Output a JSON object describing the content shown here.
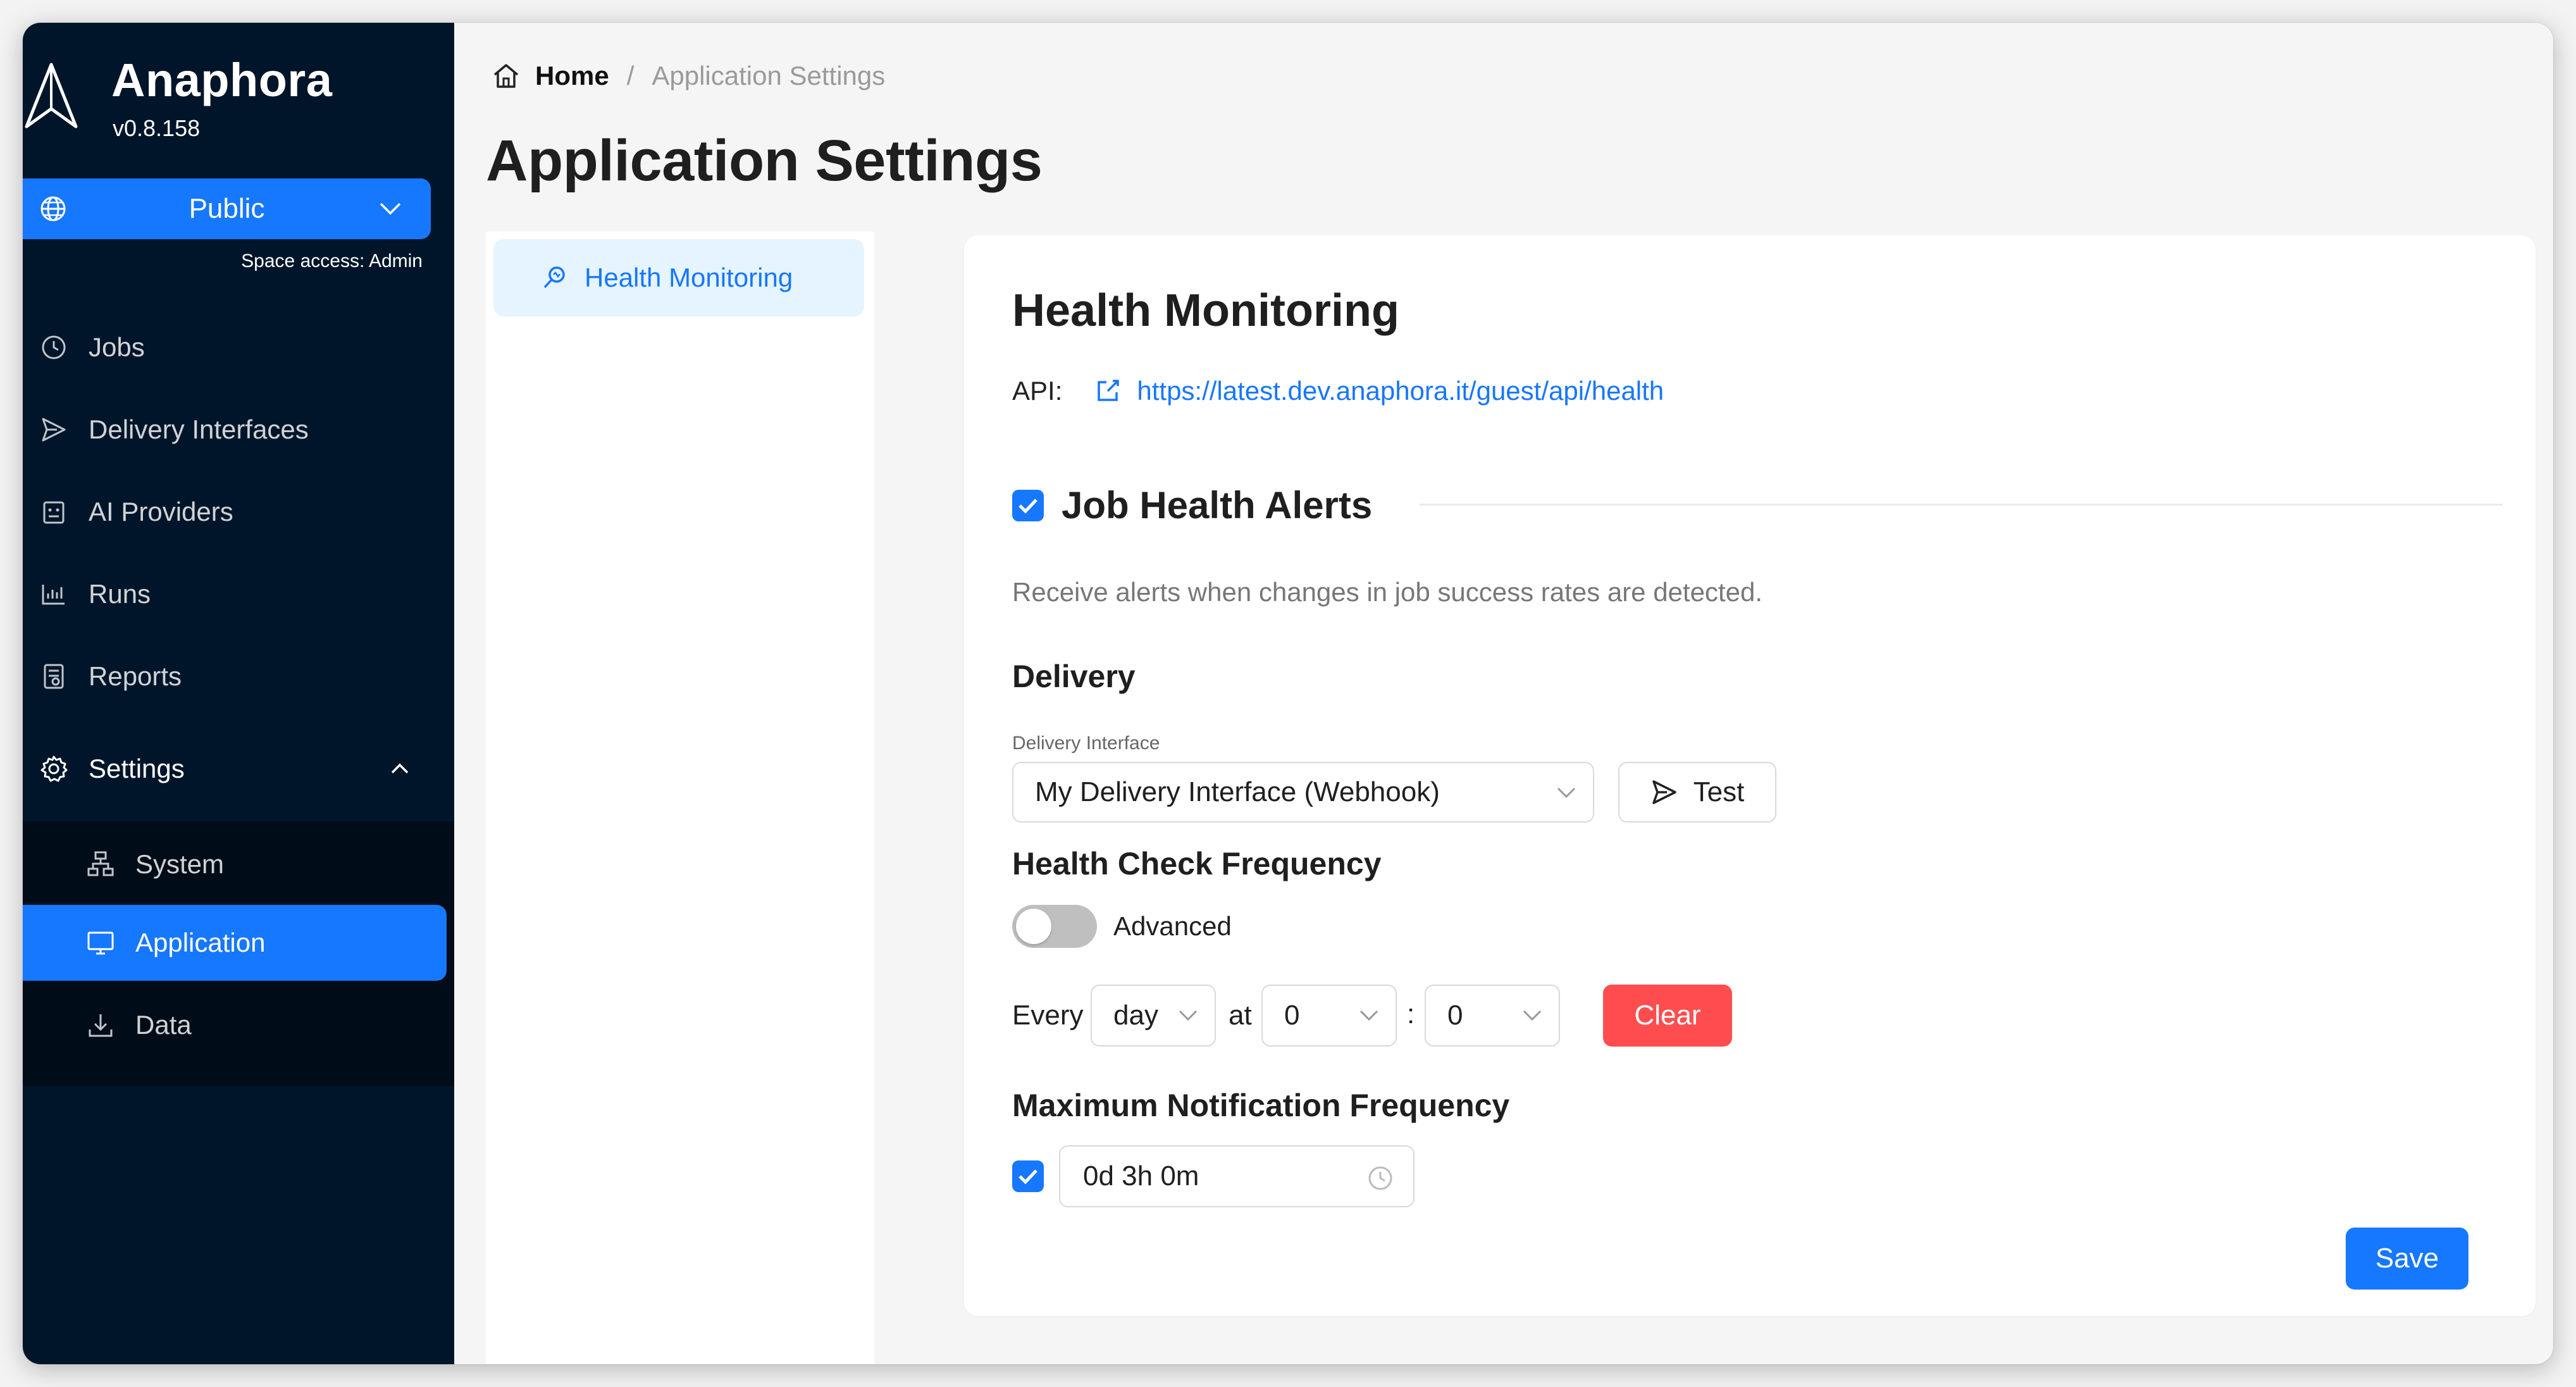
{
  "app": {
    "name": "Anaphora",
    "version": "v0.8.158"
  },
  "space": {
    "selected": "Public",
    "access": "Space access: Admin"
  },
  "nav": {
    "jobs": "Jobs",
    "delivery_interfaces": "Delivery Interfaces",
    "ai_providers": "AI Providers",
    "runs": "Runs",
    "reports": "Reports",
    "settings": "Settings",
    "sub": {
      "system": "System",
      "application": "Application",
      "data": "Data"
    }
  },
  "breadcrumb": {
    "home": "Home",
    "separator": "/",
    "current": "Application Settings"
  },
  "page": {
    "title": "Application Settings"
  },
  "subnav": {
    "health_monitoring": "Health Monitoring"
  },
  "card": {
    "title": "Health Monitoring",
    "api_label": "API:",
    "api_url": "https://latest.dev.anaphora.it/guest/api/health",
    "job_health_alerts": "Job Health Alerts",
    "job_health_alerts_checked": true,
    "description": "Receive alerts when changes in job success rates are detected.",
    "delivery": {
      "heading": "Delivery",
      "label": "Delivery Interface",
      "selected": "My Delivery Interface (Webhook)",
      "test_label": "Test"
    },
    "frequency": {
      "heading": "Health Check Frequency",
      "advanced_label": "Advanced",
      "advanced_on": false,
      "every_label": "Every",
      "period": "day",
      "at_label": "at",
      "hour": "0",
      "colon": ":",
      "minute": "0",
      "clear_label": "Clear"
    },
    "max_notification": {
      "heading": "Maximum Notification Frequency",
      "enabled": true,
      "duration": "0d 3h 0m"
    },
    "save_label": "Save"
  },
  "colors": {
    "sidebar": "#001529",
    "primary": "#1677ff",
    "danger": "#ff4d4f"
  }
}
